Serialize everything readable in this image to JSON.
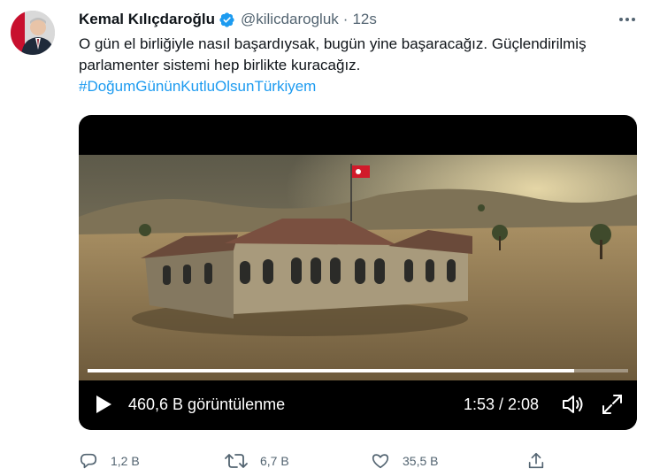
{
  "tweet": {
    "author_name": "Kemal Kılıçdaroğlu",
    "handle": "@kilicdarogluk",
    "separator": "·",
    "time": "12s",
    "text_line1": "O gün el birliğiyle nasıl başardıysak, bugün yine başaracağız. Güçlendirilmiş",
    "text_line2": "parlamenter sistemi hep birlikte kuracağız.",
    "hashtag": "#DoğumGününKutluOlsunTürkiyem"
  },
  "video": {
    "views": "460,6 B görüntülenme",
    "timecode": "1:53 / 2:08",
    "progress": 0.9
  },
  "actions": {
    "reply_count": "1,2 B",
    "retweet_count": "6,7 B",
    "like_count": "35,5 B"
  },
  "colors": {
    "accent": "#1d9bf0",
    "text": "#0f1419",
    "secondary": "#536471"
  },
  "icons": [
    "avatar",
    "verified-badge-icon",
    "more-options-icon",
    "play-icon",
    "volume-icon",
    "fullscreen-icon",
    "reply-icon",
    "retweet-icon",
    "like-icon",
    "share-icon"
  ]
}
